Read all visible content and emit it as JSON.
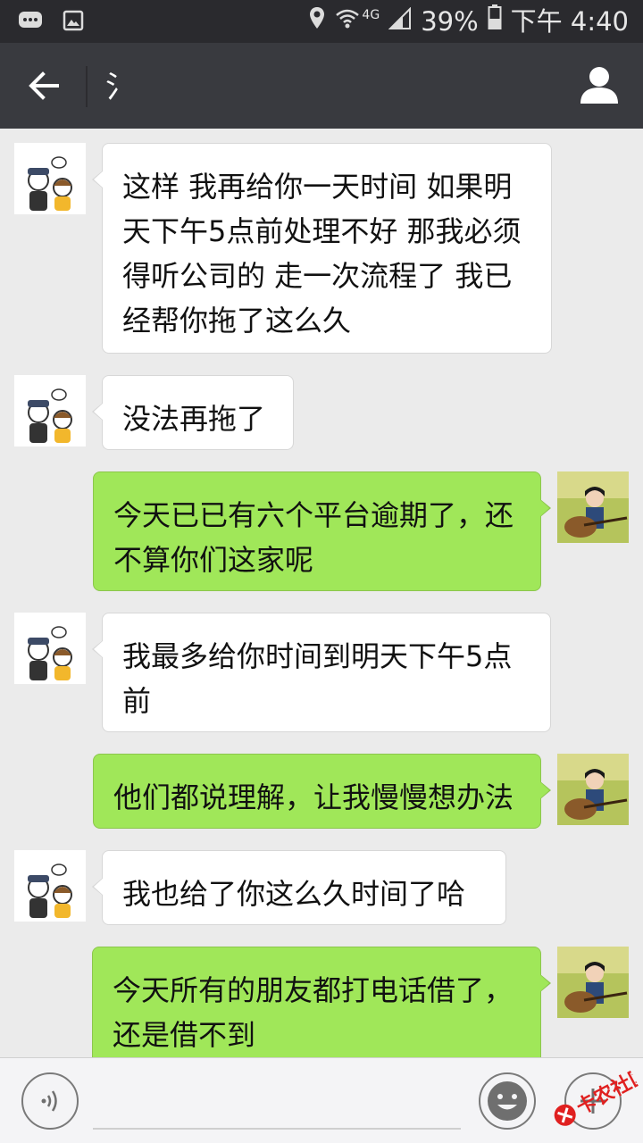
{
  "status_bar": {
    "network": "4G",
    "battery": "39%",
    "time": "下午 4:40",
    "icons": [
      "message-icon",
      "image-icon",
      "location-icon",
      "wifi-icon",
      "signal-icon",
      "battery-icon"
    ]
  },
  "title_bar": {
    "title": "氵",
    "icons": [
      "back-arrow-icon",
      "profile-icon"
    ]
  },
  "messages": [
    {
      "side": "other",
      "text": "这样  我再给你一天时间   如果明天下午5点前处理不好  那我必须得听公司的  走一次流程了 我已经帮你拖了这么久"
    },
    {
      "side": "other",
      "text": "没法再拖了"
    },
    {
      "side": "me",
      "text": "今天已已有六个平台逾期了，还不算你们这家呢"
    },
    {
      "side": "other",
      "text": "我最多给你时间到明天下午5点前"
    },
    {
      "side": "me",
      "text": "他们都说理解，让我慢慢想办法"
    },
    {
      "side": "other",
      "text": "我也给了你这么久时间了哈"
    },
    {
      "side": "me",
      "text": "今天所有的朋友都打电话借了，还是借不到"
    }
  ],
  "input_bar": {
    "placeholder": "",
    "value": "",
    "icons": [
      "voice-icon",
      "emoji-icon",
      "plus-icon"
    ]
  },
  "watermark": {
    "text": "卡农社区"
  },
  "colors": {
    "title_bar": "#393a3f",
    "status_bar": "#2a2a2e",
    "chat_bg": "#ebebeb",
    "my_bubble": "#a0e759",
    "other_bubble": "#ffffff"
  }
}
